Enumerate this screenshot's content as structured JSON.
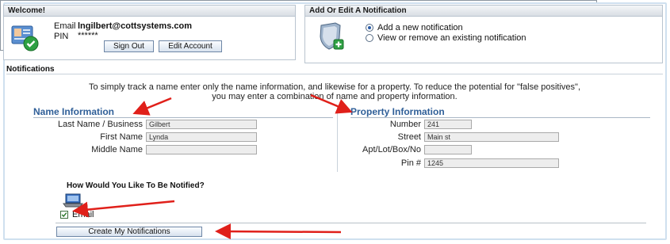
{
  "welcome": {
    "title": "Welcome!",
    "email_label": "Email",
    "email_value": "lngilbert@cottsystems.com",
    "pin_label": "PIN",
    "pin_value": "******",
    "sign_out": "Sign Out",
    "edit_account": "Edit Account"
  },
  "notify_choice": {
    "title": "Add Or Edit A Notification",
    "options": [
      "Add a new notification",
      "View or remove an existing notification"
    ],
    "selected_index": 0
  },
  "notifications": {
    "title": "Notifications",
    "intro_line1": "To simply track a name enter only the name information, and likewise for a property. To reduce the potential for \"false positives\",",
    "intro_line2": "you may enter a combination of name and property information."
  },
  "name_info": {
    "title": "Name Information",
    "last_label": "Last Name / Business",
    "last_value": "Gilbert",
    "first_label": "First Name",
    "first_value": "Lynda",
    "middle_label": "Middle Name",
    "middle_value": ""
  },
  "property_info": {
    "title": "Property Information",
    "number_label": "Number",
    "number_value": "241",
    "street_label": "Street",
    "street_value": "Main st",
    "apt_label": "Apt/Lot/Box/No",
    "apt_value": "",
    "pin_label": "Pin #",
    "pin_value": "1245"
  },
  "how_notified": {
    "title": "How Would You Like To Be Notified?",
    "email_label": "Email",
    "email_checked": true,
    "submit_label": "Create My Notifications"
  },
  "annotation_color": "#e0201a"
}
